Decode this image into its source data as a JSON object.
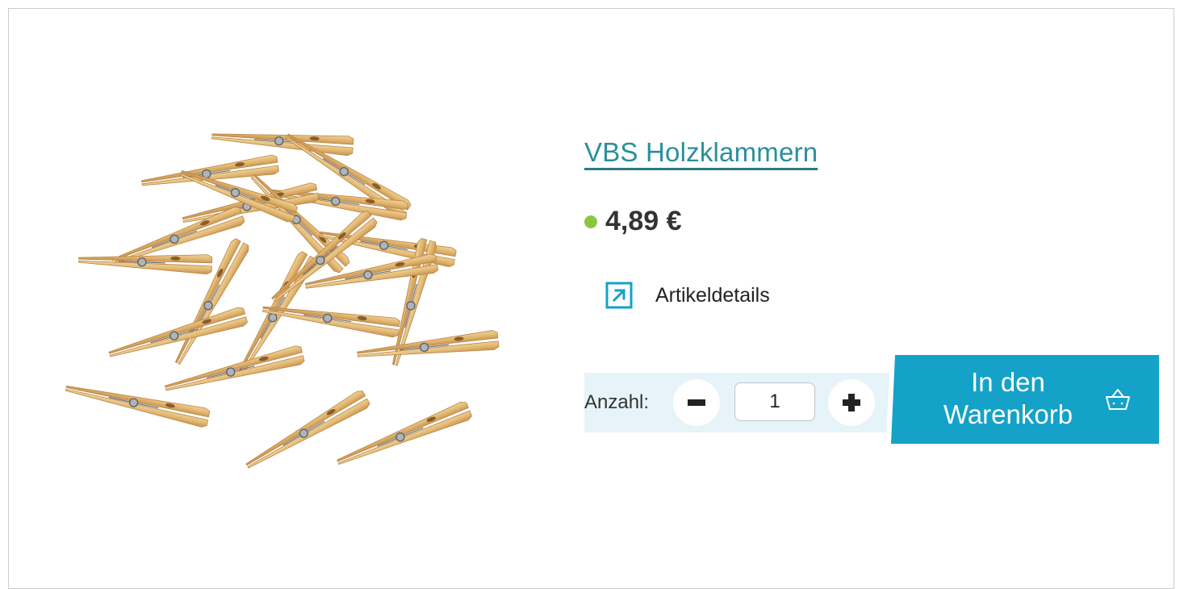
{
  "product": {
    "title": "VBS Holzklammern",
    "price": "4,89 €",
    "availability_color": "#8cc63f",
    "image_icon": "clothespins-image"
  },
  "details_link": {
    "label": "Artikeldetails",
    "icon": "external-link-arrow-icon"
  },
  "quantity": {
    "label": "Anzahl:",
    "value": "1",
    "minus_icon": "minus-icon",
    "plus_icon": "plus-icon"
  },
  "cart": {
    "label": "In den Warenkorb",
    "icon": "basket-icon",
    "color": "#14a2c8"
  }
}
